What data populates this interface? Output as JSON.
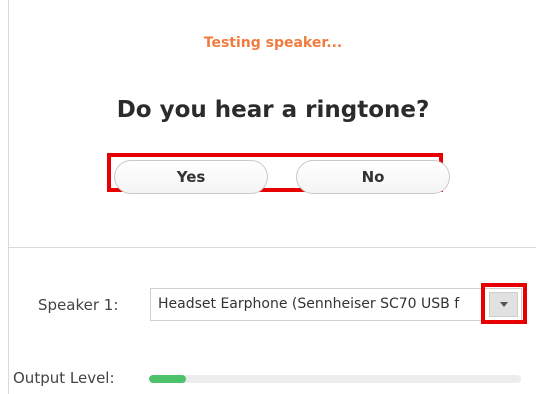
{
  "test": {
    "status": "Testing speaker...",
    "question": "Do you hear a ringtone?"
  },
  "buttons": {
    "yes_label": "Yes",
    "no_label": "No"
  },
  "speaker": {
    "label": "Speaker 1:",
    "selected": "Headset Earphone (Sennheiser SC70 USB f",
    "dropdown_icon": "chevron-down-icon"
  },
  "output": {
    "label": "Output Level:",
    "level_fraction": 0.1
  },
  "colors": {
    "status": "#f07c3f",
    "highlight": "#e60000",
    "meter": "#4cc36a"
  }
}
